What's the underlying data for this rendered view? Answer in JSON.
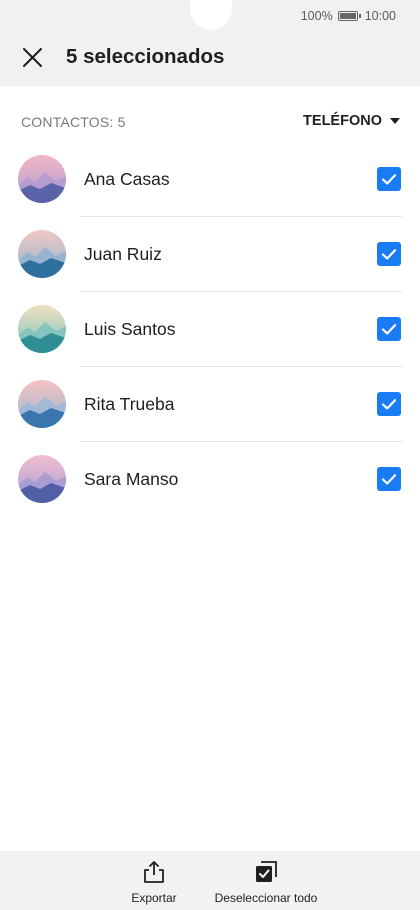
{
  "status": {
    "battery": "100%",
    "time": "10:00"
  },
  "header": {
    "title": "5 seleccionados",
    "close_icon": "close-icon"
  },
  "section": {
    "label": "CONTACTOS: 5",
    "filter": "TELÉFONO"
  },
  "contacts": [
    {
      "name": "Ana Casas",
      "checked": true
    },
    {
      "name": "Juan Ruiz",
      "checked": true
    },
    {
      "name": "Luis Santos",
      "checked": true
    },
    {
      "name": "Rita Trueba",
      "checked": true
    },
    {
      "name": "Sara Manso",
      "checked": true
    }
  ],
  "bottom": {
    "export_label": "Exportar",
    "deselect_label": "Deseleccionar todo"
  },
  "colors": {
    "accent": "#1a7cf5",
    "header_bg": "#f1f1f1",
    "bottom_bg": "#f2f2f2"
  }
}
